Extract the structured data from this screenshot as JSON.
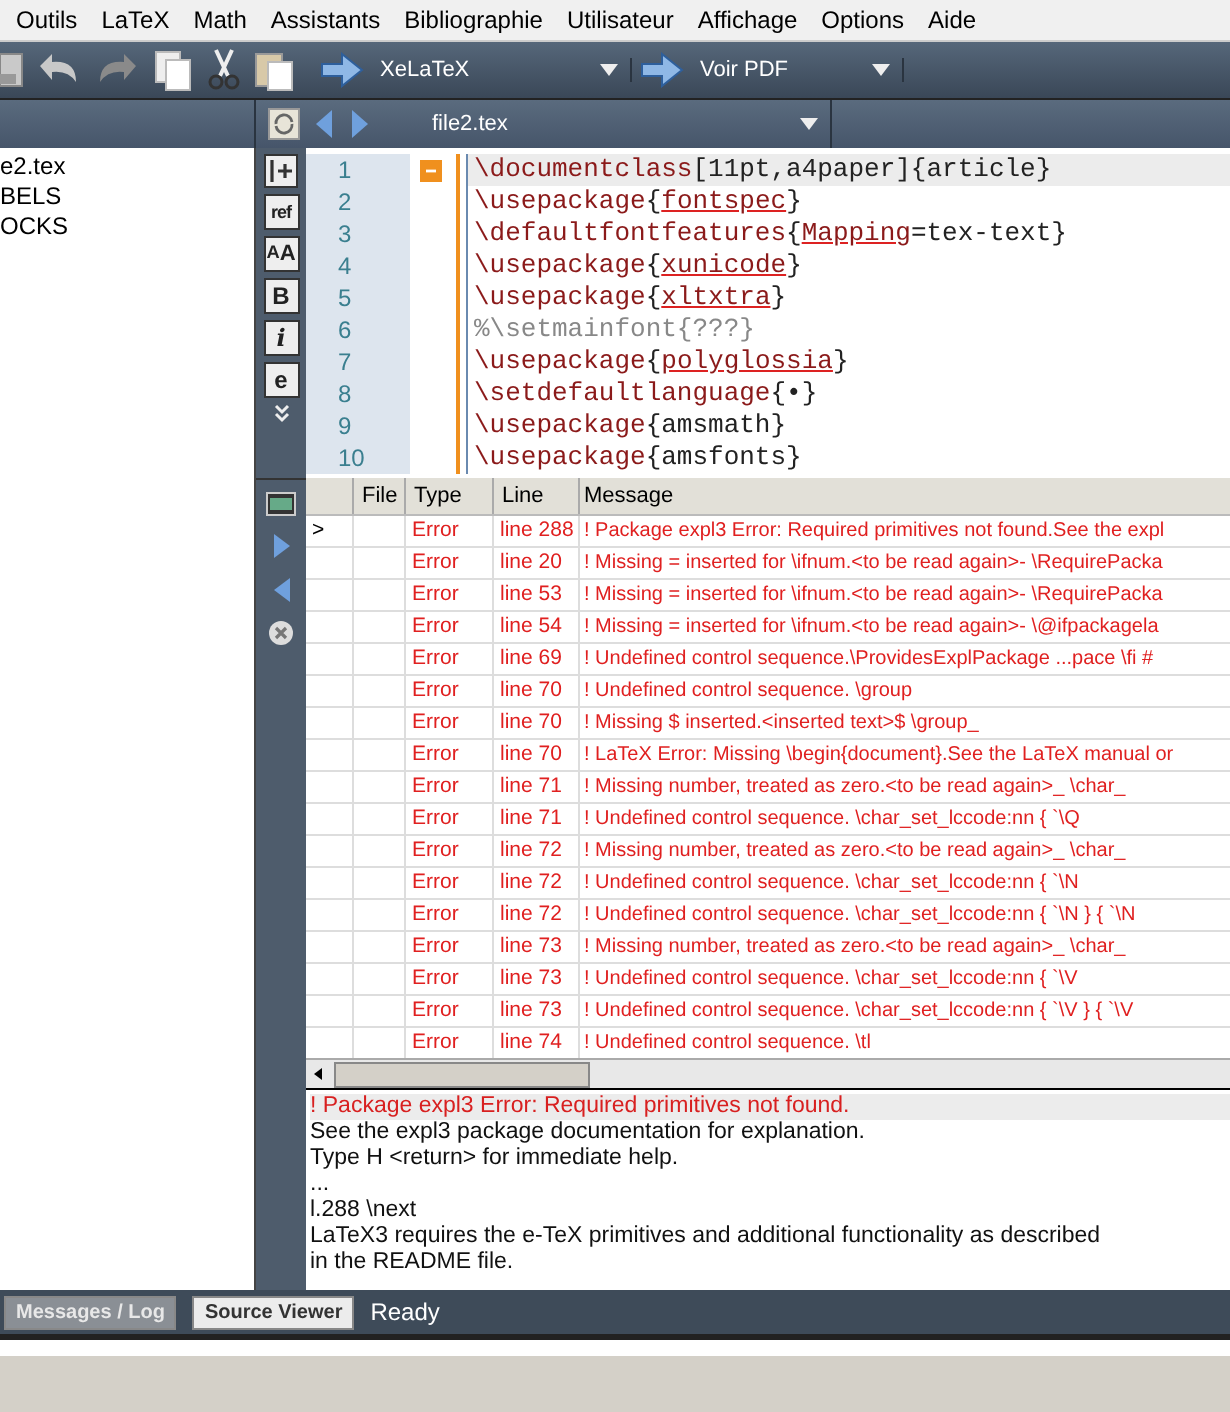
{
  "menu": [
    "Outils",
    "LaTeX",
    "Math",
    "Assistants",
    "Bibliographie",
    "Utilisateur",
    "Affichage",
    "Options",
    "Aide"
  ],
  "toolbar": {
    "compiler": "XeLaTeX",
    "viewer": "Voir PDF"
  },
  "tab_bar": {
    "file": "file2.tex"
  },
  "structure": [
    "e2.tex",
    "BELS",
    "OCKS"
  ],
  "editor_strip": [
    {
      "kind": "insert"
    },
    {
      "kind": "text",
      "label": "ref"
    },
    {
      "kind": "text",
      "label": "$_{A}$A"
    },
    {
      "kind": "text",
      "label": "B"
    },
    {
      "kind": "text",
      "label": "i"
    },
    {
      "kind": "text",
      "label": "e"
    },
    {
      "kind": "more"
    }
  ],
  "message_strip": [
    {
      "kind": "console"
    },
    {
      "kind": "next"
    },
    {
      "kind": "prev"
    },
    {
      "kind": "clear"
    }
  ],
  "editor": {
    "lines": [
      {
        "number": "1",
        "current": true,
        "foldable": true,
        "segments": [
          {
            "kind": "cmd",
            "text": "\\documentclass"
          },
          {
            "kind": "plain",
            "text": "[11pt,a4paper]{article}"
          }
        ]
      },
      {
        "number": "2",
        "current": false,
        "foldable": false,
        "segments": [
          {
            "kind": "cmd",
            "text": "\\usepackage"
          },
          {
            "kind": "plain",
            "text": "{"
          },
          {
            "kind": "misspelled",
            "text": "fontspec"
          },
          {
            "kind": "plain",
            "text": "}"
          }
        ]
      },
      {
        "number": "3",
        "current": false,
        "foldable": false,
        "segments": [
          {
            "kind": "cmd",
            "text": "\\defaultfontfeatures"
          },
          {
            "kind": "plain",
            "text": "{"
          },
          {
            "kind": "misspelled",
            "text": "Mapping"
          },
          {
            "kind": "plain",
            "text": "=tex-text}"
          }
        ]
      },
      {
        "number": "4",
        "current": false,
        "foldable": false,
        "segments": [
          {
            "kind": "cmd",
            "text": "\\usepackage"
          },
          {
            "kind": "plain",
            "text": "{"
          },
          {
            "kind": "misspelled",
            "text": "xunicode"
          },
          {
            "kind": "plain",
            "text": "}"
          }
        ]
      },
      {
        "number": "5",
        "current": false,
        "foldable": false,
        "segments": [
          {
            "kind": "cmd",
            "text": "\\usepackage"
          },
          {
            "kind": "plain",
            "text": "{"
          },
          {
            "kind": "misspelled",
            "text": "xltxtra"
          },
          {
            "kind": "plain",
            "text": "}"
          }
        ]
      },
      {
        "number": "6",
        "current": false,
        "foldable": false,
        "segments": [
          {
            "kind": "comment",
            "text": "%\\setmainfont{???}"
          }
        ]
      },
      {
        "number": "7",
        "current": false,
        "foldable": false,
        "segments": [
          {
            "kind": "cmd",
            "text": "\\usepackage"
          },
          {
            "kind": "plain",
            "text": "{"
          },
          {
            "kind": "misspelled",
            "text": "polyglossia"
          },
          {
            "kind": "plain",
            "text": "}"
          }
        ]
      },
      {
        "number": "8",
        "current": false,
        "foldable": false,
        "segments": [
          {
            "kind": "cmd",
            "text": "\\setdefaultlanguage"
          },
          {
            "kind": "plain",
            "text": "{•}"
          }
        ]
      },
      {
        "number": "9",
        "current": false,
        "foldable": false,
        "segments": [
          {
            "kind": "cmd",
            "text": "\\usepackage"
          },
          {
            "kind": "plain",
            "text": "{amsmath}"
          }
        ]
      },
      {
        "number": "10",
        "current": false,
        "foldable": false,
        "segments": [
          {
            "kind": "cmd",
            "text": "\\usepackage"
          },
          {
            "kind": "plain",
            "text": "{amsfonts}"
          }
        ]
      }
    ]
  },
  "messages": {
    "columns": [
      "File",
      "Type",
      "Line",
      "Message"
    ],
    "rows": [
      {
        "marker": ">",
        "file": "",
        "type": "Error",
        "line": "line 288",
        "message": "! Package expl3 Error: Required primitives not found.See the expl"
      },
      {
        "marker": "",
        "file": "",
        "type": "Error",
        "line": "line 20",
        "message": "! Missing = inserted for \\ifnum.<to be read again>- \\RequirePacka"
      },
      {
        "marker": "",
        "file": "",
        "type": "Error",
        "line": "line 53",
        "message": "! Missing = inserted for \\ifnum.<to be read again>- \\RequirePacka"
      },
      {
        "marker": "",
        "file": "",
        "type": "Error",
        "line": "line 54",
        "message": "! Missing = inserted for \\ifnum.<to be read again>- \\@ifpackagela"
      },
      {
        "marker": "",
        "file": "",
        "type": "Error",
        "line": "line 69",
        "message": "! Undefined control sequence.\\ProvidesExplPackage ...pace \\fi #"
      },
      {
        "marker": "",
        "file": "",
        "type": "Error",
        "line": "line 70",
        "message": "! Undefined control sequence. \\group"
      },
      {
        "marker": "",
        "file": "",
        "type": "Error",
        "line": "line 70",
        "message": "! Missing $ inserted.<inserted text>$ \\group_"
      },
      {
        "marker": "",
        "file": "",
        "type": "Error",
        "line": "line 70",
        "message": "! LaTeX Error: Missing \\begin{document}.See the LaTeX manual or"
      },
      {
        "marker": "",
        "file": "",
        "type": "Error",
        "line": "line 71",
        "message": "! Missing number, treated as zero.<to be read again>_ \\char_"
      },
      {
        "marker": "",
        "file": "",
        "type": "Error",
        "line": "line 71",
        "message": "! Undefined control sequence. \\char_set_lccode:nn { `\\Q"
      },
      {
        "marker": "",
        "file": "",
        "type": "Error",
        "line": "line 72",
        "message": "! Missing number, treated as zero.<to be read again>_ \\char_"
      },
      {
        "marker": "",
        "file": "",
        "type": "Error",
        "line": "line 72",
        "message": "! Undefined control sequence. \\char_set_lccode:nn { `\\N"
      },
      {
        "marker": "",
        "file": "",
        "type": "Error",
        "line": "line 72",
        "message": "! Undefined control sequence. \\char_set_lccode:nn { `\\N } { `\\N"
      },
      {
        "marker": "",
        "file": "",
        "type": "Error",
        "line": "line 73",
        "message": "! Missing number, treated as zero.<to be read again>_ \\char_"
      },
      {
        "marker": "",
        "file": "",
        "type": "Error",
        "line": "line 73",
        "message": "! Undefined control sequence. \\char_set_lccode:nn { `\\V"
      },
      {
        "marker": "",
        "file": "",
        "type": "Error",
        "line": "line 73",
        "message": "! Undefined control sequence. \\char_set_lccode:nn { `\\V } { `\\V"
      },
      {
        "marker": "",
        "file": "",
        "type": "Error",
        "line": "line 74",
        "message": "! Undefined control sequence. \\tl"
      }
    ]
  },
  "log": [
    {
      "kind": "error",
      "text": "! Package expl3 Error: Required primitives not found."
    },
    {
      "kind": "text",
      "text": "See the expl3 package documentation for explanation."
    },
    {
      "kind": "text",
      "text": "Type H <return> for immediate help."
    },
    {
      "kind": "text",
      "text": "..."
    },
    {
      "kind": "text",
      "text": "l.288 \\next"
    },
    {
      "kind": "text",
      "text": "LaTeX3 requires the e-TeX primitives and additional functionality as described"
    },
    {
      "kind": "text",
      "text": "in the README file."
    }
  ],
  "status_bar": {
    "buttons": [
      {
        "label": "Messages / Log",
        "selected": true
      },
      {
        "label": "Source Viewer",
        "selected": false
      }
    ],
    "status": "Ready"
  }
}
